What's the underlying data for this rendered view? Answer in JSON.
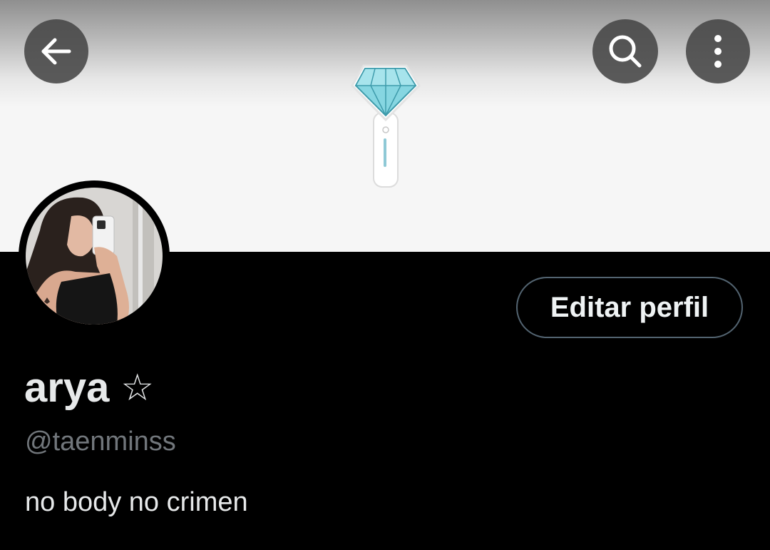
{
  "header": {
    "back_icon": "arrow-left-icon",
    "search_icon": "search-icon",
    "more_icon": "more-vertical-icon",
    "banner_image": "lightstick-diamond"
  },
  "profile": {
    "display_name": "arya",
    "name_decoration": "☆",
    "handle": "@taenminss",
    "bio": "no body no crimen",
    "edit_button_label": "Editar perfil"
  },
  "colors": {
    "background": "#000000",
    "primary_text": "#e7e9ea",
    "secondary_text": "#71767b",
    "button_border": "#536471",
    "lightstick_teal": "#7fd3dd"
  }
}
